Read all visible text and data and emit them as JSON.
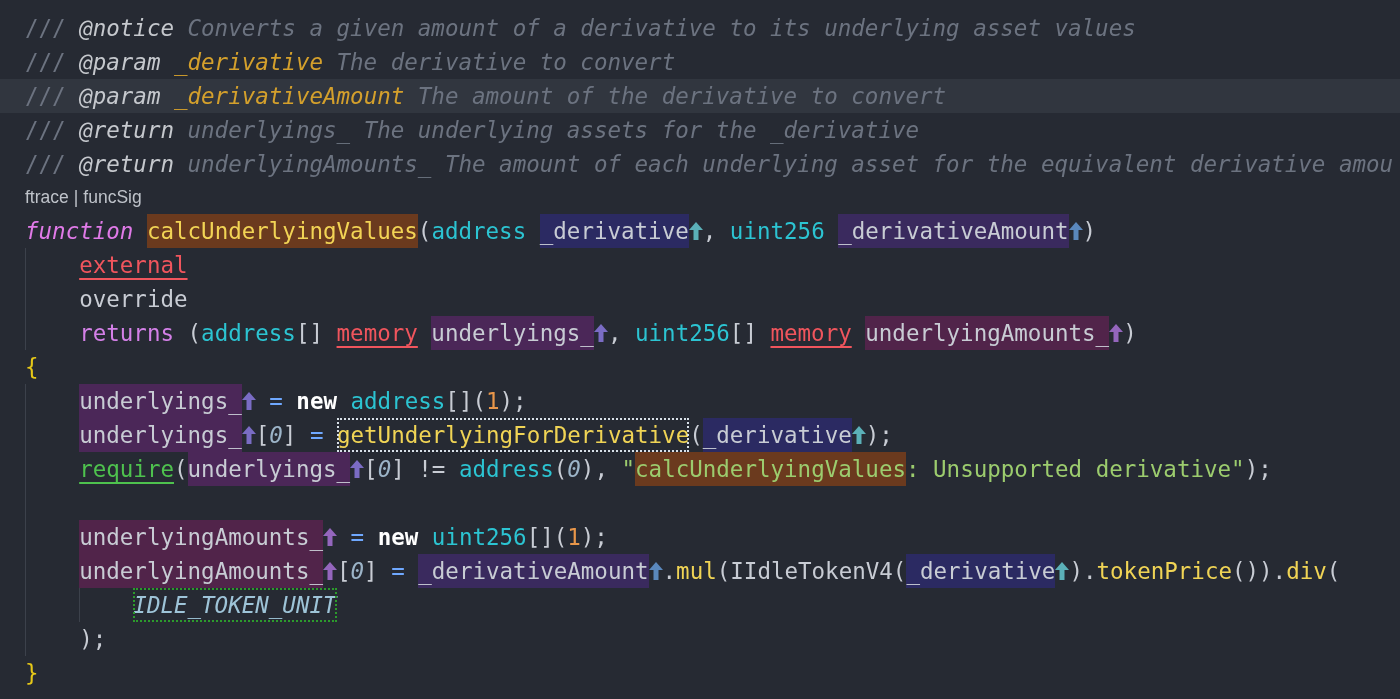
{
  "editor": {
    "lines": [
      {
        "kind": "code",
        "current": false,
        "tokens": [
          {
            "kind": "slash",
            "text": "///",
            "space_after": true
          },
          {
            "kind": "doctag",
            "text": "@notice",
            "space_after": true
          },
          {
            "kind": "comment",
            "text": "Converts a given amount of a derivative to its underlying asset values"
          }
        ]
      },
      {
        "kind": "code",
        "current": false,
        "tokens": [
          {
            "kind": "slash",
            "text": "///",
            "space_after": true
          },
          {
            "kind": "doctag",
            "text": "@param",
            "space_after": true
          },
          {
            "kind": "docparam",
            "text": "_derivative",
            "space_after": true
          },
          {
            "kind": "comment",
            "text": "The derivative to convert"
          }
        ]
      },
      {
        "kind": "code",
        "current": true,
        "tokens": [
          {
            "kind": "slash",
            "text": "///",
            "space_after": true
          },
          {
            "kind": "doctag",
            "text": "@param",
            "space_after": true
          },
          {
            "kind": "docparam",
            "text": "_derivativeAmount",
            "space_after": true
          },
          {
            "kind": "comment",
            "text": "The amount of the derivative to convert"
          }
        ]
      },
      {
        "kind": "code",
        "current": false,
        "tokens": [
          {
            "kind": "slash",
            "text": "///",
            "space_after": true
          },
          {
            "kind": "doctag",
            "text": "@return",
            "space_after": true
          },
          {
            "kind": "comment",
            "text": "underlyings_ The underlying assets for the _derivative"
          }
        ]
      },
      {
        "kind": "code",
        "current": false,
        "tokens": [
          {
            "kind": "slash",
            "text": "///",
            "space_after": true
          },
          {
            "kind": "doctag",
            "text": "@return",
            "space_after": true
          },
          {
            "kind": "comment",
            "text": "underlyingAmounts_ The amount of each underlying asset for the equivalent derivative amou"
          }
        ]
      },
      {
        "kind": "codelens",
        "links": [
          "ftrace",
          "funcSig"
        ],
        "separator": "|"
      },
      {
        "kind": "code",
        "current": false,
        "tokens": [
          {
            "kind": "storage",
            "text": "function",
            "space_after": true
          },
          {
            "kind": "fndecl",
            "text": "calcUnderlyingValues"
          },
          {
            "kind": "plain",
            "text": "("
          },
          {
            "kind": "type",
            "text": "address",
            "space_after": true
          },
          {
            "kind": "arg1",
            "text": "_derivative",
            "arrow": true
          },
          {
            "kind": "plain",
            "text": ", "
          },
          {
            "kind": "type",
            "text": "uint256",
            "space_after": true
          },
          {
            "kind": "arg2",
            "text": "_derivativeAmount",
            "arrow": true
          },
          {
            "kind": "plain",
            "text": ")"
          }
        ],
        "children": [
          {
            "kind": "code",
            "current": false,
            "tokens": [
              {
                "kind": "warn",
                "text": "external"
              }
            ]
          },
          {
            "kind": "code",
            "current": false,
            "tokens": [
              {
                "kind": "plain",
                "text": "override"
              }
            ]
          },
          {
            "kind": "code",
            "current": false,
            "tokens": [
              {
                "kind": "keyword",
                "text": "returns"
              },
              {
                "kind": "plain",
                "text": " ("
              },
              {
                "kind": "type",
                "text": "address"
              },
              {
                "kind": "plain",
                "text": "[]",
                "space_after": true
              },
              {
                "kind": "warn",
                "text": "memory",
                "space_after": true
              },
              {
                "kind": "ret1",
                "text": "underlyings_",
                "arrow": true
              },
              {
                "kind": "plain",
                "text": ", "
              },
              {
                "kind": "type",
                "text": "uint256"
              },
              {
                "kind": "plain",
                "text": "[]",
                "space_after": true
              },
              {
                "kind": "warn",
                "text": "memory",
                "space_after": true
              },
              {
                "kind": "ret2",
                "text": "underlyingAmounts_",
                "arrow": true
              },
              {
                "kind": "plain",
                "text": ")"
              }
            ]
          }
        ]
      },
      {
        "kind": "code",
        "current": false,
        "tokens": [
          {
            "kind": "brace",
            "text": "{"
          }
        ],
        "children": [
          {
            "kind": "code",
            "current": false,
            "tokens": [
              {
                "kind": "ret1",
                "text": "underlyings_",
                "arrow": true,
                "space_after": true
              },
              {
                "kind": "op",
                "text": "=",
                "space_after": true
              },
              {
                "kind": "new",
                "text": "new",
                "space_after": true
              },
              {
                "kind": "type",
                "text": "address"
              },
              {
                "kind": "plain",
                "text": "[]("
              },
              {
                "kind": "num",
                "text": "1"
              },
              {
                "kind": "plain",
                "text": ");"
              }
            ]
          },
          {
            "kind": "code",
            "current": false,
            "tokens": [
              {
                "kind": "ret1",
                "text": "underlyings_",
                "arrow": true
              },
              {
                "kind": "plain",
                "text": "["
              },
              {
                "kind": "index",
                "text": "0"
              },
              {
                "kind": "plain",
                "text": "]",
                "space_after": true
              },
              {
                "kind": "op",
                "text": "=",
                "space_after": true
              },
              {
                "kind": "call",
                "text": "getUnderlyingForDerivative",
                "boxed": true
              },
              {
                "kind": "plain",
                "text": "("
              },
              {
                "kind": "arg1",
                "text": "_derivative",
                "arrow": true
              },
              {
                "kind": "plain",
                "text": ");"
              }
            ]
          },
          {
            "kind": "code",
            "current": false,
            "tokens": [
              {
                "kind": "require",
                "text": "require"
              },
              {
                "kind": "plain",
                "text": "("
              },
              {
                "kind": "ret1",
                "text": "underlyings_",
                "arrow": true
              },
              {
                "kind": "plain",
                "text": "["
              },
              {
                "kind": "index",
                "text": "0"
              },
              {
                "kind": "plain",
                "text": "] != "
              },
              {
                "kind": "type",
                "text": "address"
              },
              {
                "kind": "plain",
                "text": "("
              },
              {
                "kind": "index",
                "text": "0"
              },
              {
                "kind": "plain",
                "text": "), "
              },
              {
                "kind": "str",
                "text": "\""
              },
              {
                "kind": "strhl",
                "text": "calcUnderlyingValues"
              },
              {
                "kind": "str",
                "text": ": Unsupported derivative\""
              },
              {
                "kind": "plain",
                "text": ");"
              }
            ]
          },
          {
            "kind": "blank"
          },
          {
            "kind": "code",
            "current": false,
            "tokens": [
              {
                "kind": "ret2",
                "text": "underlyingAmounts_",
                "arrow": true,
                "space_after": true
              },
              {
                "kind": "op",
                "text": "=",
                "space_after": true
              },
              {
                "kind": "new",
                "text": "new",
                "space_after": true
              },
              {
                "kind": "type",
                "text": "uint256"
              },
              {
                "kind": "plain",
                "text": "[]("
              },
              {
                "kind": "num",
                "text": "1"
              },
              {
                "kind": "plain",
                "text": ");"
              }
            ]
          },
          {
            "kind": "code",
            "current": false,
            "tokens": [
              {
                "kind": "ret2",
                "text": "underlyingAmounts_",
                "arrow": true
              },
              {
                "kind": "plain",
                "text": "["
              },
              {
                "kind": "index",
                "text": "0"
              },
              {
                "kind": "plain",
                "text": "]",
                "space_after": true
              },
              {
                "kind": "op",
                "text": "=",
                "space_after": true
              },
              {
                "kind": "arg2",
                "text": "_derivativeAmount",
                "arrow": true
              },
              {
                "kind": "plain",
                "text": "."
              },
              {
                "kind": "call",
                "text": "mul"
              },
              {
                "kind": "plain",
                "text": "(IIdleTokenV4("
              },
              {
                "kind": "arg1",
                "text": "_derivative",
                "arrow": true
              },
              {
                "kind": "plain",
                "text": ")."
              },
              {
                "kind": "call",
                "text": "tokenPrice"
              },
              {
                "kind": "plain",
                "text": "())."
              },
              {
                "kind": "call",
                "text": "div"
              },
              {
                "kind": "plain",
                "text": "("
              }
            ],
            "children": [
              {
                "kind": "code",
                "current": false,
                "tokens": [
                  {
                    "kind": "const",
                    "text": "IDLE_TOKEN_UNIT",
                    "boxed": true
                  }
                ]
              }
            ]
          },
          {
            "kind": "code",
            "current": false,
            "tokens": [
              {
                "kind": "plain",
                "text": ");"
              }
            ]
          }
        ]
      },
      {
        "kind": "code",
        "current": false,
        "tokens": [
          {
            "kind": "brace",
            "text": "}"
          }
        ]
      }
    ]
  }
}
